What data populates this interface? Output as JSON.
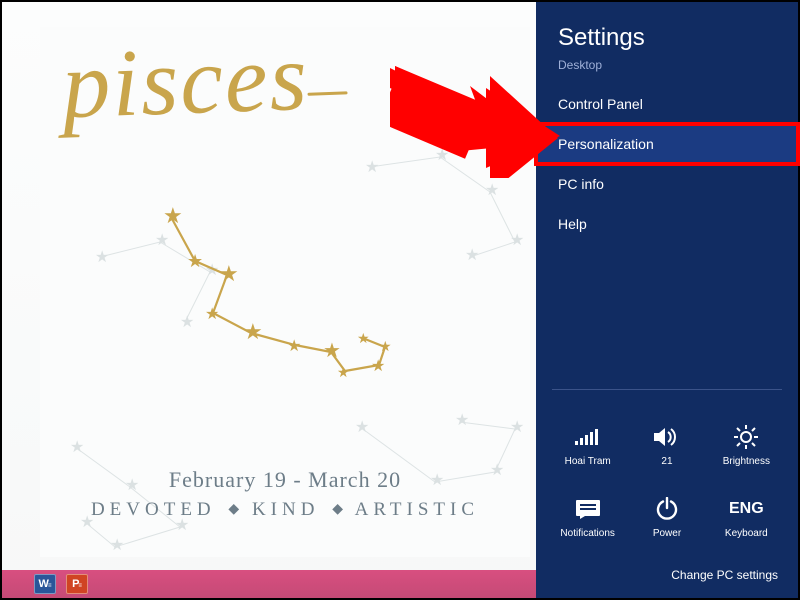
{
  "desktop": {
    "poster": {
      "title": "pisces",
      "dates": "February 19 - March 20",
      "traits": [
        "DEVOTED",
        "KIND",
        "ARTISTIC"
      ]
    }
  },
  "taskbar": {
    "items": [
      {
        "id": "word",
        "label": "W"
      },
      {
        "id": "powerpoint",
        "label": "P"
      }
    ]
  },
  "charms": {
    "title": "Settings",
    "subtitle": "Desktop",
    "items": [
      {
        "label": "Control Panel"
      },
      {
        "label": "Personalization",
        "highlighted": true
      },
      {
        "label": "PC info"
      },
      {
        "label": "Help"
      }
    ],
    "tiles": [
      {
        "icon": "signal-icon",
        "label": "Hoai Tram"
      },
      {
        "icon": "volume-icon",
        "label": "21"
      },
      {
        "icon": "brightness-icon",
        "label": "Brightness"
      },
      {
        "icon": "notifications-icon",
        "label": "Notifications"
      },
      {
        "icon": "power-icon",
        "label": "Power"
      },
      {
        "icon": "keyboard-icon",
        "label": "Keyboard",
        "textIcon": "ENG"
      }
    ],
    "change": "Change PC settings"
  },
  "annotation": {
    "arrow": true
  }
}
